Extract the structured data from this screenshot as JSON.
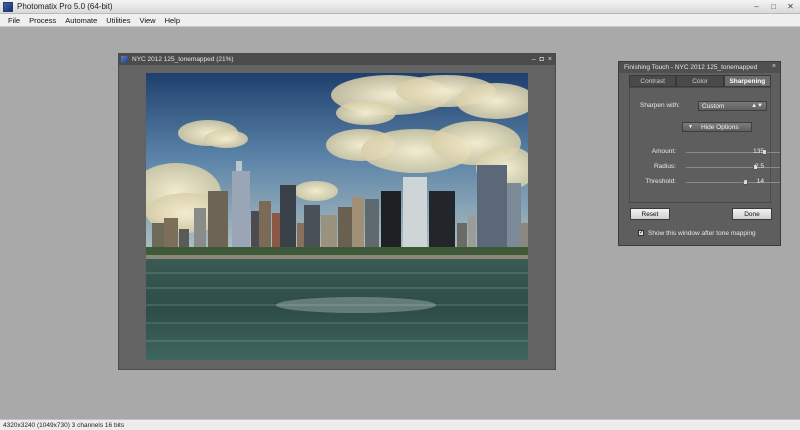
{
  "app": {
    "title": "Photomatix Pro 5.0 (64-bit)"
  },
  "window_controls": {
    "minimize": "–",
    "maximize": "□",
    "close": "✕"
  },
  "menu": [
    "File",
    "Process",
    "Automate",
    "Utilities",
    "View",
    "Help"
  ],
  "document": {
    "title": "NYC 2012 125_tonemapped (21%)",
    "controls": {
      "minimize": "–",
      "maximize": "◘",
      "close": "×"
    }
  },
  "finishing_touch": {
    "title": "Finishing Touch - NYC 2012 125_tonemapped",
    "close": "×",
    "tabs": [
      "Contrast",
      "Color",
      "Sharpening"
    ],
    "active_tab": "Sharpening",
    "sharpen_label": "Sharpen with:",
    "sharpen_value": "Custom",
    "dropdown_arrow": "▲▼",
    "options_toggle_icon": "▼",
    "options_button": "Hide Options",
    "sliders": [
      {
        "label": "Amount:",
        "value": "135",
        "fraction": 0.84
      },
      {
        "label": "Radius:",
        "value": "2.5",
        "fraction": 0.74
      },
      {
        "label": "Threshold:",
        "value": "14",
        "fraction": 0.64
      }
    ],
    "reset_label": "Reset",
    "done_label": "Done",
    "show_window_checked": true,
    "check_mark": "✓",
    "show_window_label": "Show this window after tone mapping"
  },
  "statusbar": {
    "text": "4320x3240 (1049x730) 3 channels 16 bits"
  }
}
